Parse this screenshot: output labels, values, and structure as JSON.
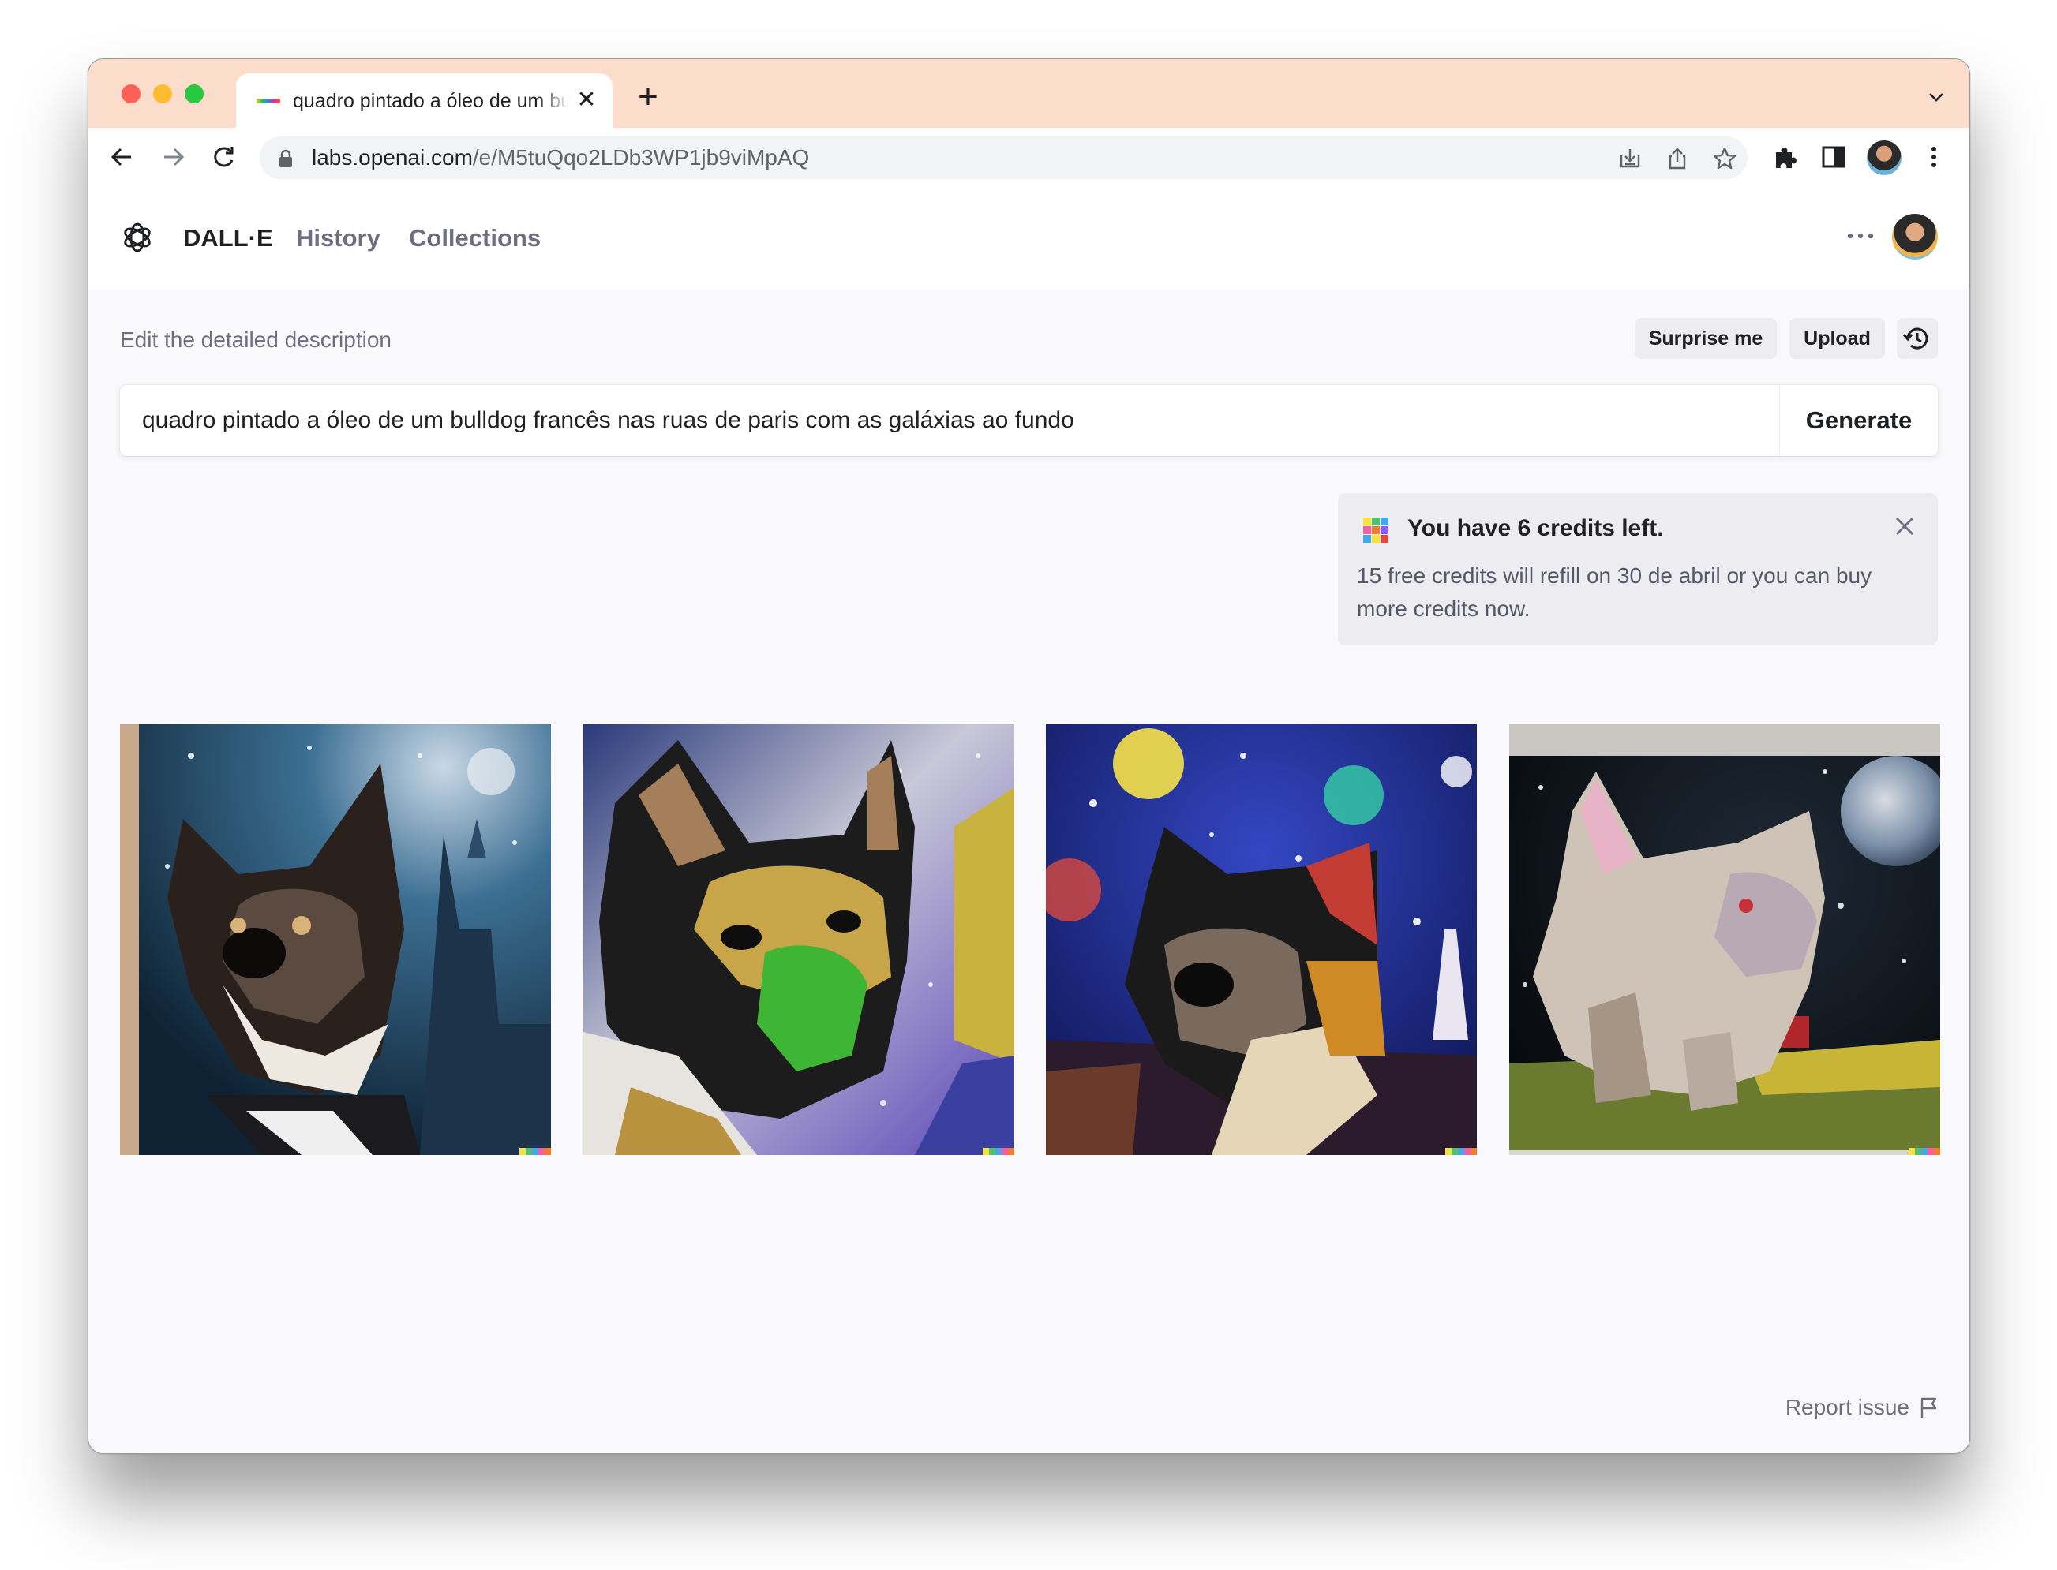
{
  "browser": {
    "tab_title": "quadro pintado a óleo de um bulldog francês nas ruas de paris com as galáxias ao fundo",
    "url_host": "labs.openai.com",
    "url_path": "/e/M5tuQqo2LDb3WP1jb9viMpAQ"
  },
  "app": {
    "brand": "DALL·E",
    "nav": {
      "history": "History",
      "collections": "Collections"
    }
  },
  "editor": {
    "label": "Edit the detailed description",
    "surprise_label": "Surprise me",
    "upload_label": "Upload",
    "prompt": "quadro pintado a óleo de um bulldog francês nas ruas de paris com as galáxias ao fundo",
    "generate_label": "Generate"
  },
  "notice": {
    "title": "You have 6 credits left.",
    "body": "15 free credits will refill on 30 de abril or you can buy more credits now."
  },
  "results": {
    "count": 4,
    "images": [
      "Oil painting of a French bulldog with a blue starry night city background",
      "Oil painting of a French bulldog with green and yellow tones and a purple galaxy street",
      "Oil painting of a French bulldog under a colorful starry sky with the Eiffel Tower",
      "Oil painting of a French bulldog sitting with a planet and galaxy behind"
    ]
  },
  "footer": {
    "report_label": "Report issue"
  },
  "colors": {
    "tab_strip": "#fcdcca",
    "page_bg": "#f9f9fb",
    "notice_bg": "#ececf1",
    "text_primary": "#202123",
    "text_muted": "#6e6e80"
  },
  "icons": {
    "back": "arrow-left-icon",
    "forward": "arrow-right-icon",
    "reload": "reload-icon",
    "lock": "lock-icon",
    "install": "install-icon",
    "share": "share-icon",
    "bookmark": "star-icon",
    "extensions": "puzzle-icon",
    "sidebar": "sidebar-icon",
    "menu": "kebab-menu-icon",
    "logo": "openai-logo-icon",
    "history": "history-clock-icon",
    "close": "close-icon",
    "flag": "flag-icon"
  }
}
